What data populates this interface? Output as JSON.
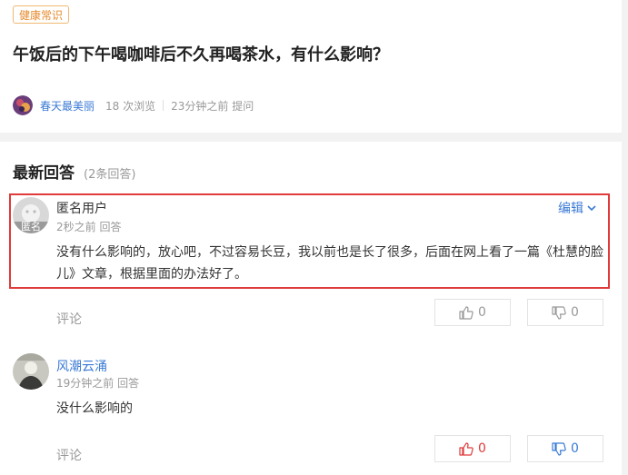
{
  "question": {
    "tag": "健康常识",
    "title": "午饭后的下午喝咖啡后不久再喝茶水，有什么影响？",
    "author": "春天最美丽",
    "views": "18 次浏览",
    "time": "23分钟之前 提问"
  },
  "answers_header": {
    "title": "最新回答",
    "count": "(2条回答)"
  },
  "answers": [
    {
      "avatar_badge": "匿名",
      "user": "匿名用户",
      "time": "2秒之前 回答",
      "edit_label": "编辑",
      "body": "没有什么影响的，放心吧，不过容易长豆，我以前也是长了很多，后面在网上看了一篇《杜慧的脸儿》文章，根据里面的办法好了。",
      "comment_label": "评论",
      "up": "0",
      "down": "0"
    },
    {
      "user": "风潮云涌",
      "time": "19分钟之前 回答",
      "body": "没什么影响的",
      "comment_label": "评论",
      "up": "0",
      "down": "0"
    }
  ],
  "colors": {
    "accent_blue": "#3a7ad5",
    "highlight_red": "#e03a3a",
    "tag_orange": "#e68a2e"
  }
}
